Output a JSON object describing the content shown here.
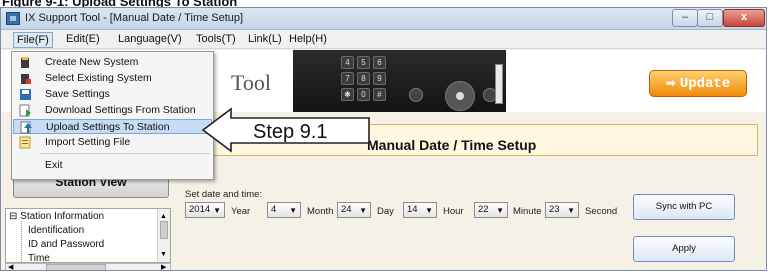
{
  "caption": "Figure 9-1: Upload Settings To Station",
  "window": {
    "title": "IX Support Tool - [Manual Date / Time Setup]",
    "minimize_glyph": "–",
    "maximize_glyph": "□",
    "close_glyph": "x"
  },
  "menubar": {
    "items": [
      {
        "label": "File(F)"
      },
      {
        "label": "Edit(E)"
      },
      {
        "label": "Language(V)"
      },
      {
        "label": "Tools(T)"
      },
      {
        "label": "Link(L)"
      },
      {
        "label": "Help(H)"
      }
    ]
  },
  "file_menu": {
    "items": [
      {
        "label": "Create New System",
        "icon": "new-system-icon"
      },
      {
        "label": "Select Existing System",
        "icon": "existing-system-icon"
      },
      {
        "label": "Save Settings",
        "icon": "save-icon"
      },
      {
        "label": "Download Settings From Station",
        "icon": "download-icon"
      },
      {
        "label": "Upload Settings To Station",
        "icon": "upload-icon"
      },
      {
        "label": "Import Setting File",
        "icon": "import-file-icon"
      },
      {
        "label": "Exit",
        "icon": ""
      }
    ],
    "highlighted_index": 4
  },
  "header": {
    "tool_text": "Tool",
    "update_label": "Update",
    "keys": [
      "4",
      "5",
      "6",
      "7",
      "8",
      "9",
      "✱",
      "0",
      "#"
    ]
  },
  "callout": {
    "text": "Step 9.1"
  },
  "page": {
    "title": "Manual Date / Time Setup"
  },
  "sidebar": {
    "station_view_label": "Station View",
    "tree": [
      {
        "label": "Station Information",
        "expander": "⊟"
      },
      {
        "label": "Identification"
      },
      {
        "label": "ID and Password"
      },
      {
        "label": "Time"
      }
    ]
  },
  "date_time": {
    "label": "Set date and time:",
    "year": "2014",
    "year_unit": "Year",
    "month": "4",
    "month_unit": "Month",
    "day": "24",
    "day_unit": "Day",
    "hour": "14",
    "hour_unit": "Hour",
    "minute": "22",
    "minute_unit": "Minute",
    "second": "23",
    "second_unit": "Second"
  },
  "buttons": {
    "sync_label": "Sync with PC",
    "apply_label": "Apply"
  },
  "colors": {
    "accent_orange": "#f08a0a",
    "highlight_blue": "#c6dcf4",
    "title_box": "#fff7df"
  }
}
